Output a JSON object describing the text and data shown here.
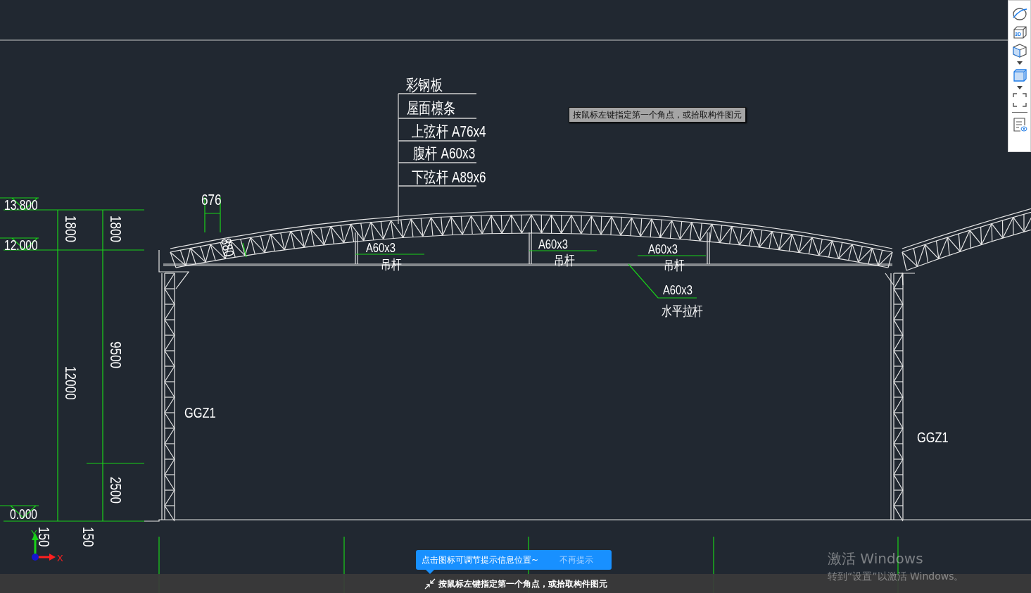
{
  "drawing": {
    "legend": [
      "彩钢板",
      "屋面檩条",
      "上弦杆 A76x4",
      "腹杆 A60x3",
      "下弦杆 A89x6"
    ],
    "elevations": [
      "13.800",
      "12.000",
      "0.000"
    ],
    "vertical_dimensions": [
      "1800",
      "1800",
      "12000",
      "9500",
      "2500",
      "150",
      "150"
    ],
    "truss_dimensions": [
      "676",
      "880"
    ],
    "member_labels": [
      {
        "size": "A60x3",
        "name": "吊杆"
      },
      {
        "size": "A60x3",
        "name": "吊杆"
      },
      {
        "size": "A60x3",
        "name": "吊杆"
      },
      {
        "size": "A60x3",
        "name": "水平拉杆"
      }
    ],
    "column_labels": [
      "GGZ1",
      "GGZ1"
    ],
    "axis": {
      "y": "Y",
      "x": "X"
    }
  },
  "toolbar": {
    "view_3d_label": "3D"
  },
  "cursor_tooltip": "按鼠标左键指定第一个角点，或拾取构件图元",
  "hint_bubble": {
    "text": "点击图标可调节提示信息位置~",
    "dismiss": "不再提示"
  },
  "status_bar": {
    "prompt": "按鼠标左键指定第一个角点，或拾取构件图元"
  },
  "watermark": {
    "title": "激活 Windows",
    "subtitle": "转到“设置”以激活 Windows。"
  }
}
